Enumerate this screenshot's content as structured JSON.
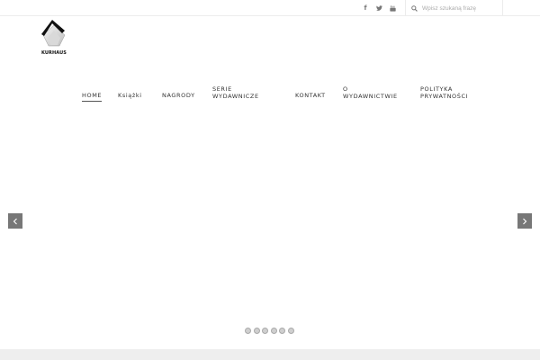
{
  "topbar": {
    "social": [
      {
        "name": "facebook",
        "icon": "facebook-icon",
        "glyph": "f"
      },
      {
        "name": "twitter",
        "icon": "twitter-icon"
      },
      {
        "name": "youtube",
        "icon": "youtube-icon"
      }
    ],
    "search": {
      "placeholder": "Wpisz szukaną frazę",
      "value": "",
      "icon": "search-icon"
    }
  },
  "logo": {
    "text": "KURHAUS"
  },
  "nav": {
    "items": [
      {
        "label": "HOME",
        "active": true
      },
      {
        "label": "Książki"
      },
      {
        "label": "NAGRODY"
      },
      {
        "label_line1": "SERIE",
        "label_line2": "WYDAWNICZE"
      },
      {
        "label": "KONTAKT"
      },
      {
        "label_line1": "O",
        "label_line2": "WYDAWNICTWIE"
      },
      {
        "label_line1": "POLITYKA",
        "label_line2": "PRYWATNOŚCI"
      }
    ]
  },
  "slider": {
    "prev_icon": "chevron-left-icon",
    "next_icon": "chevron-right-icon",
    "dot_count": 6
  },
  "colors": {
    "accent": "#777777",
    "border": "#ececec",
    "footer": "#eeeeee"
  }
}
